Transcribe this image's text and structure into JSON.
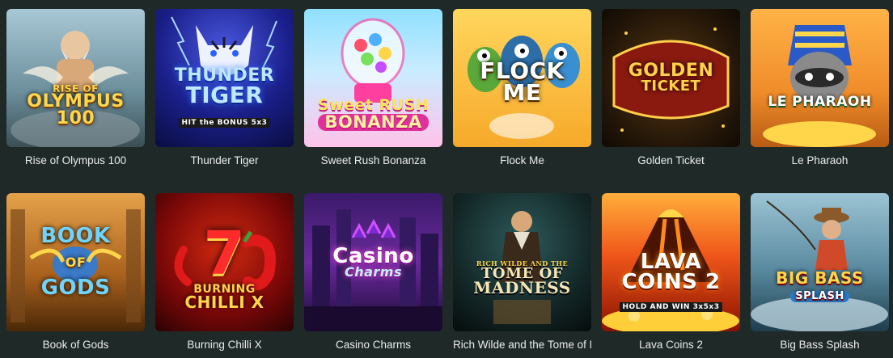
{
  "games": [
    {
      "title": "Rise of Olympus 100",
      "logo": "RISE OF OLYMPUS 100",
      "icon": "zeus-icon",
      "colors": [
        "#8fb6c9",
        "#5c7b86"
      ]
    },
    {
      "title": "Thunder Tiger",
      "logo": "THUNDER TIGER",
      "icon": "tiger-icon",
      "colors": [
        "#2b2f9e",
        "#0e1550"
      ]
    },
    {
      "title": "Sweet Rush Bonanza",
      "logo": "Sweet RUSH BONANZA",
      "icon": "gumball-machine-icon",
      "colors": [
        "#9fe6ff",
        "#ffb3e6"
      ]
    },
    {
      "title": "Flock Me",
      "logo": "FLOCK ME",
      "icon": "birds-icon",
      "colors": [
        "#ffcf4a",
        "#f29a1b"
      ]
    },
    {
      "title": "Golden Ticket",
      "logo": "GOLDEN TICKET",
      "icon": "ticket-icon",
      "colors": [
        "#3a2a12",
        "#120c06"
      ]
    },
    {
      "title": "Le Pharaoh",
      "logo": "LE PHARAOH",
      "icon": "raccoon-pharaoh-icon",
      "colors": [
        "#f3a63a",
        "#d97b1b"
      ]
    },
    {
      "title": "Book of Gods",
      "logo": "BOOK OF GODS",
      "icon": "scarab-icon",
      "colors": [
        "#d9903a",
        "#6b3a10"
      ]
    },
    {
      "title": "Burning Chilli X",
      "logo": "BURNING CHILLI X",
      "icon": "seven-chilli-icon",
      "colors": [
        "#b01010",
        "#3a0404"
      ]
    },
    {
      "title": "Casino Charms",
      "logo": "Casino Charms",
      "icon": "city-night-icon",
      "colors": [
        "#5a2a8c",
        "#1c0a3a"
      ]
    },
    {
      "title": "Rich Wilde and the Tome of Madness",
      "logo": "TOME OF MADNESS",
      "icon": "explorer-icon",
      "colors": [
        "#1f3a3a",
        "#0a1414"
      ]
    },
    {
      "title": "Lava Coins 2",
      "logo": "LAVA COINS 2",
      "icon": "volcano-icon",
      "colors": [
        "#ff7a1a",
        "#8c1a00"
      ]
    },
    {
      "title": "Big Bass Splash",
      "logo": "BIG BASS SPLASH",
      "icon": "fisherman-icon",
      "colors": [
        "#6fa0b8",
        "#24485a"
      ]
    }
  ],
  "logos": {
    "olympus_a": "RISE OF",
    "olympus_b": "OLYMPUS",
    "olympus_c": "100",
    "thunder_a": "THUNDER",
    "thunder_b": "TIGER",
    "thunder_c": "HIT the BONUS 5x3",
    "sweet_a": "Sweet RUSH",
    "sweet_b": "BONANZA",
    "flock": "FLOCK ME",
    "golden_a": "GOLDEN",
    "golden_b": "TICKET",
    "pharaoh": "LE PHARAOH",
    "book_a": "BOOK",
    "book_b": "OF",
    "book_c": "GODS",
    "chilli_a": "7",
    "chilli_b": "BURNING",
    "chilli_c": "CHILLI X",
    "casino_a": "Casino",
    "casino_b": "Charms",
    "tome_a": "RICH WILDE AND THE",
    "tome_b": "TOME OF",
    "tome_c": "MADNESS",
    "lava_a": "LAVA",
    "lava_b": "COINS 2",
    "lava_c": "HOLD AND WIN 3x5x3",
    "bass_a": "BIG BASS",
    "bass_b": "SPLASH"
  }
}
